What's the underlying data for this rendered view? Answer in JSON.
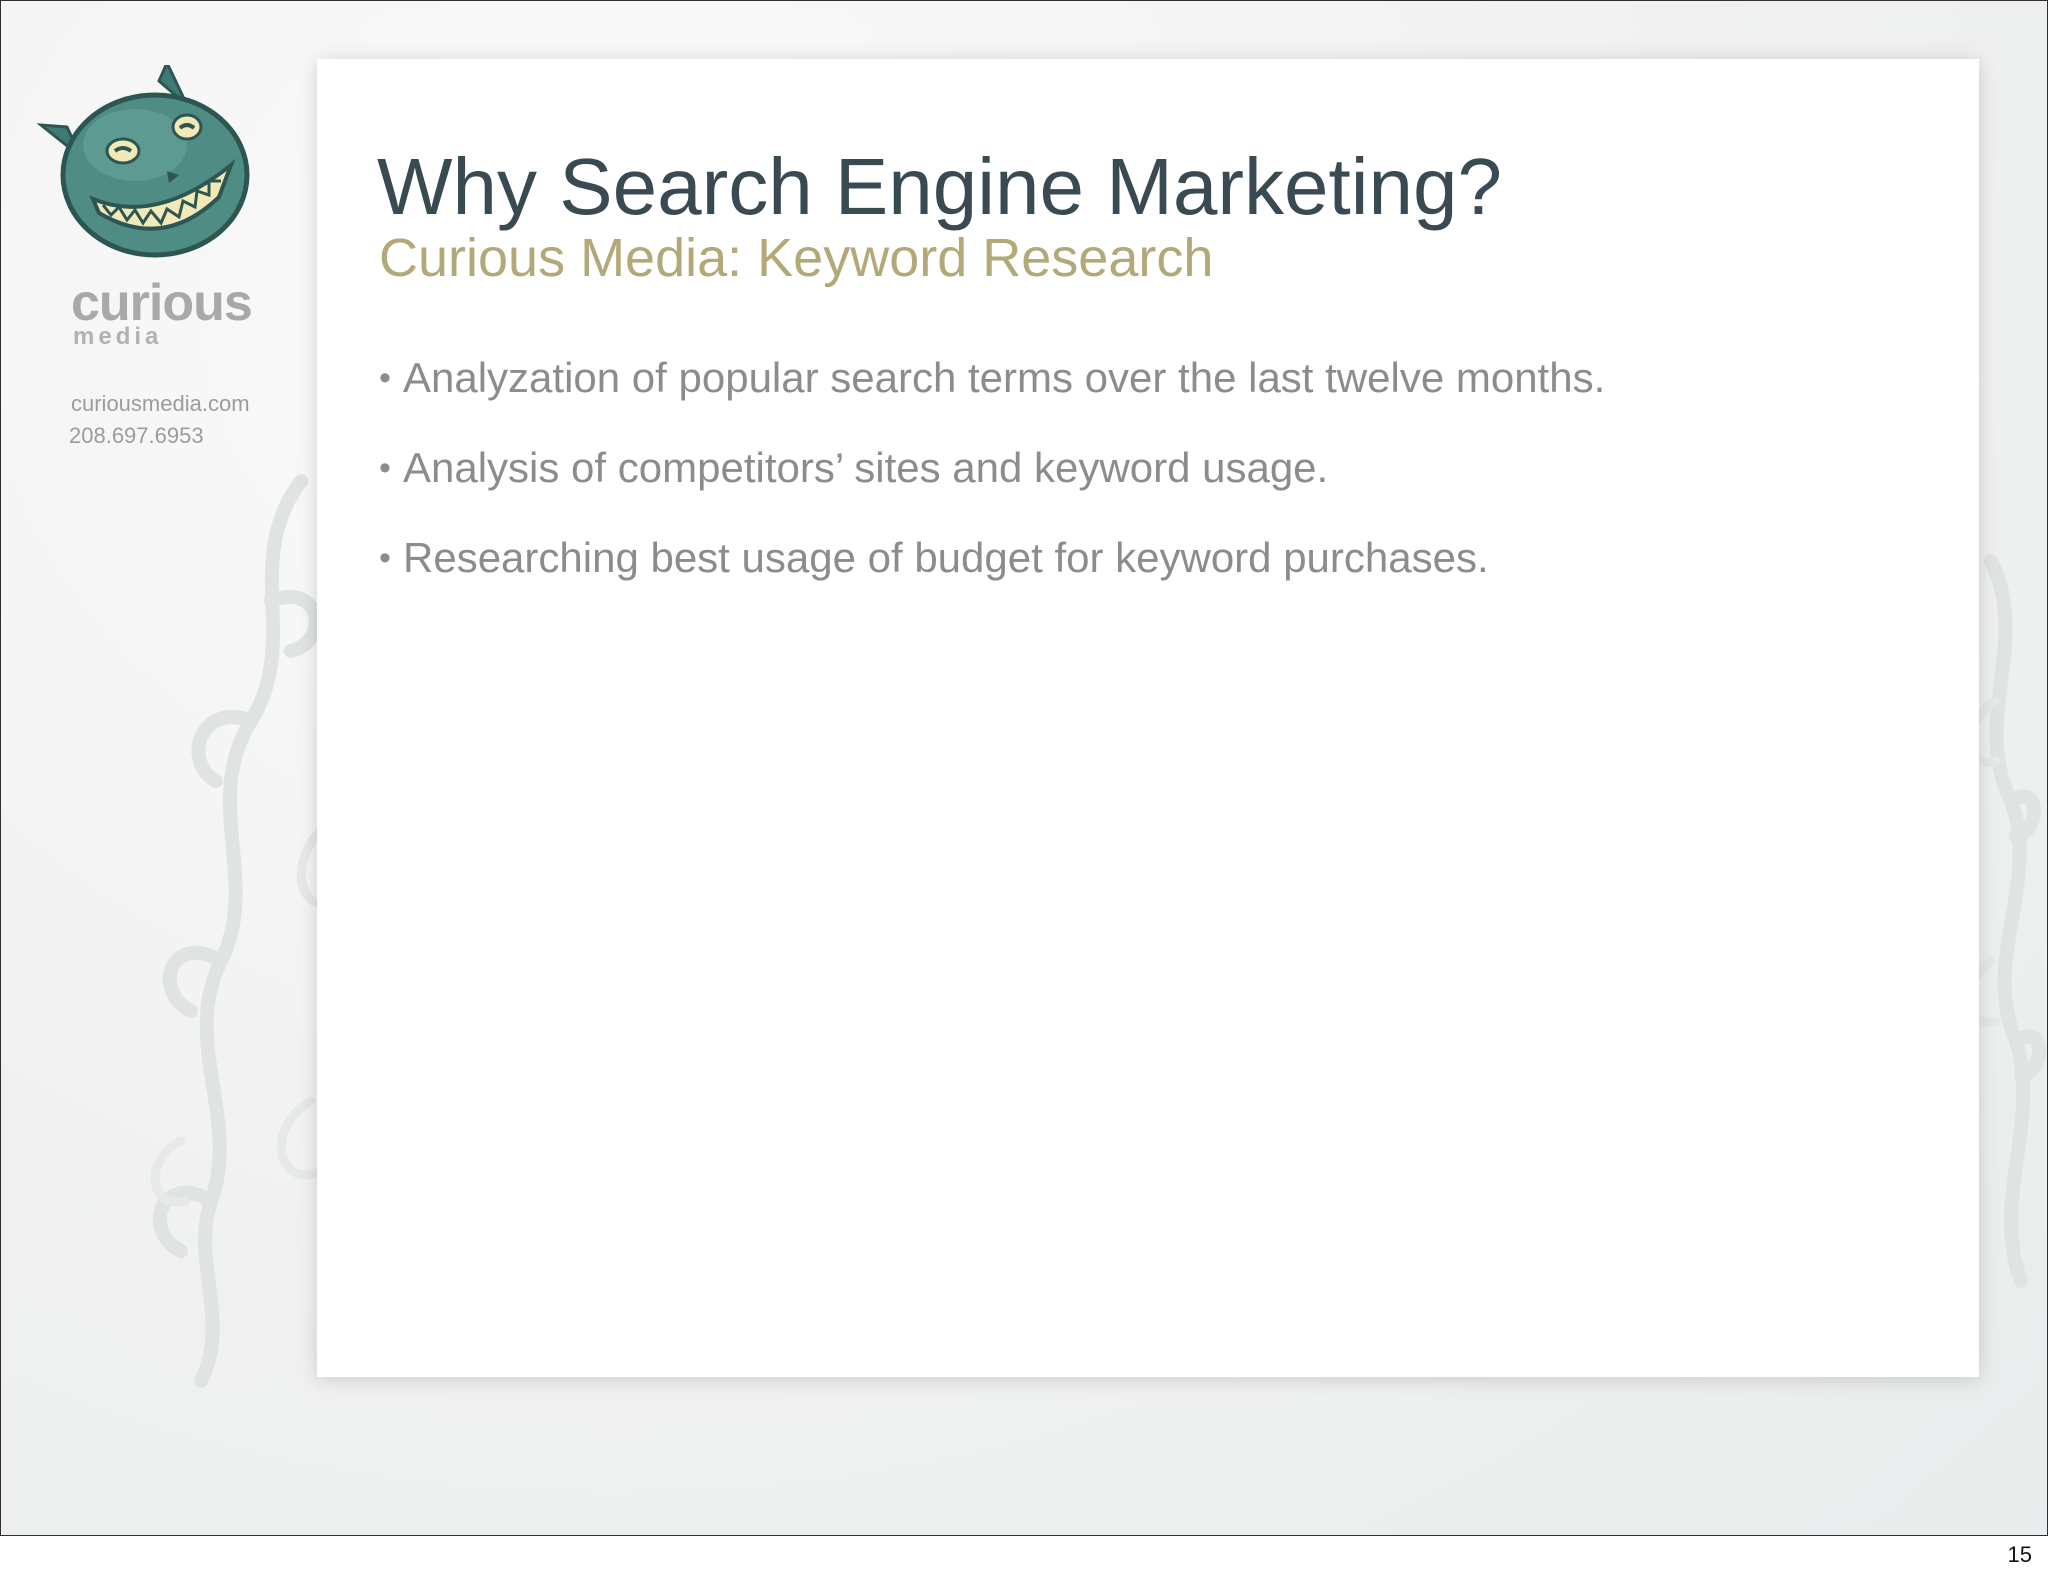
{
  "brand": {
    "name_main": "curious",
    "name_sub": "media",
    "website": "curiousmedia.com",
    "phone": "208.697.6953",
    "logo_icon": "grinning-cat-mascot-icon"
  },
  "slide": {
    "title": "Why Search Engine Marketing?",
    "subtitle": "Curious Media: Keyword Research",
    "bullets": [
      "Analyzation of popular search terms over the last twelve months.",
      "Analysis of competitors’ sites and keyword usage.",
      "Researching best usage of budget for keyword purchases."
    ]
  },
  "footer": {
    "page_number": "15"
  },
  "colors": {
    "title": "#3a4a52",
    "subtitle": "#b3a878",
    "body": "#8c8c8c",
    "mascot": "#4e8c84"
  }
}
